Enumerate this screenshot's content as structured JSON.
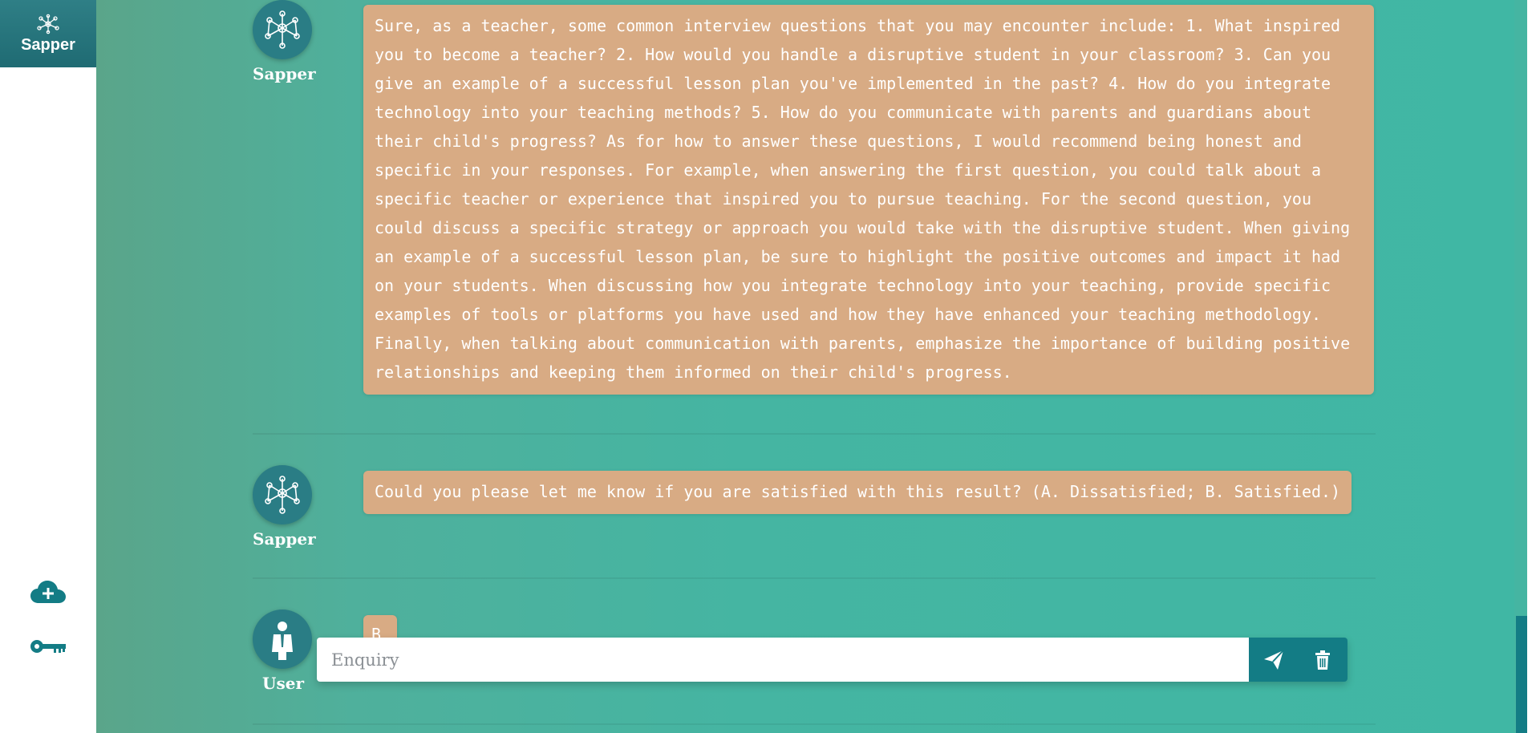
{
  "app": {
    "title": "Sapper"
  },
  "sidebar": {
    "logo_label": "Sapper",
    "buttons": [
      {
        "icon": "cloud-plus-icon"
      },
      {
        "icon": "key-icon"
      }
    ]
  },
  "messages": [
    {
      "sender": "Sapper",
      "avatar_icon": "network-icon",
      "text": "Sure, as a teacher, some common interview questions that you may encounter include: 1. What inspired you to become a teacher? 2. How would you handle a disruptive student in your classroom? 3. Can you give an example of a successful lesson plan you've implemented in the past? 4. How do you integrate technology into your teaching methods? 5. How do you communicate with parents and guardians about their child's progress? As for how to answer these questions, I would recommend being honest and specific in your responses. For example, when answering the first question, you could talk about a specific teacher or experience that inspired you to pursue teaching. For the second question, you could discuss a specific strategy or approach you would take with the disruptive student. When giving an example of a successful lesson plan, be sure to highlight the positive outcomes and impact it had on your students. When discussing how you integrate technology into your teaching, provide specific examples of tools or platforms you have used and how they have enhanced your teaching methodology. Finally, when talking about communication with parents, emphasize the importance of building positive relationships and keeping them informed on their child's progress."
    },
    {
      "sender": "Sapper",
      "avatar_icon": "network-icon",
      "text": "Could you please let me know if you are satisfied with this result? (A. Dissatisfied; B. Satisfied.)"
    },
    {
      "sender": "User",
      "avatar_icon": "user-tie-icon",
      "text": "B"
    }
  ],
  "input": {
    "placeholder": "Enquiry",
    "value": "",
    "send_icon": "send-icon",
    "delete_icon": "trash-icon"
  },
  "colors": {
    "accent": "#137c85",
    "bubble": "#d8ab84",
    "background": "#40b7a4"
  }
}
